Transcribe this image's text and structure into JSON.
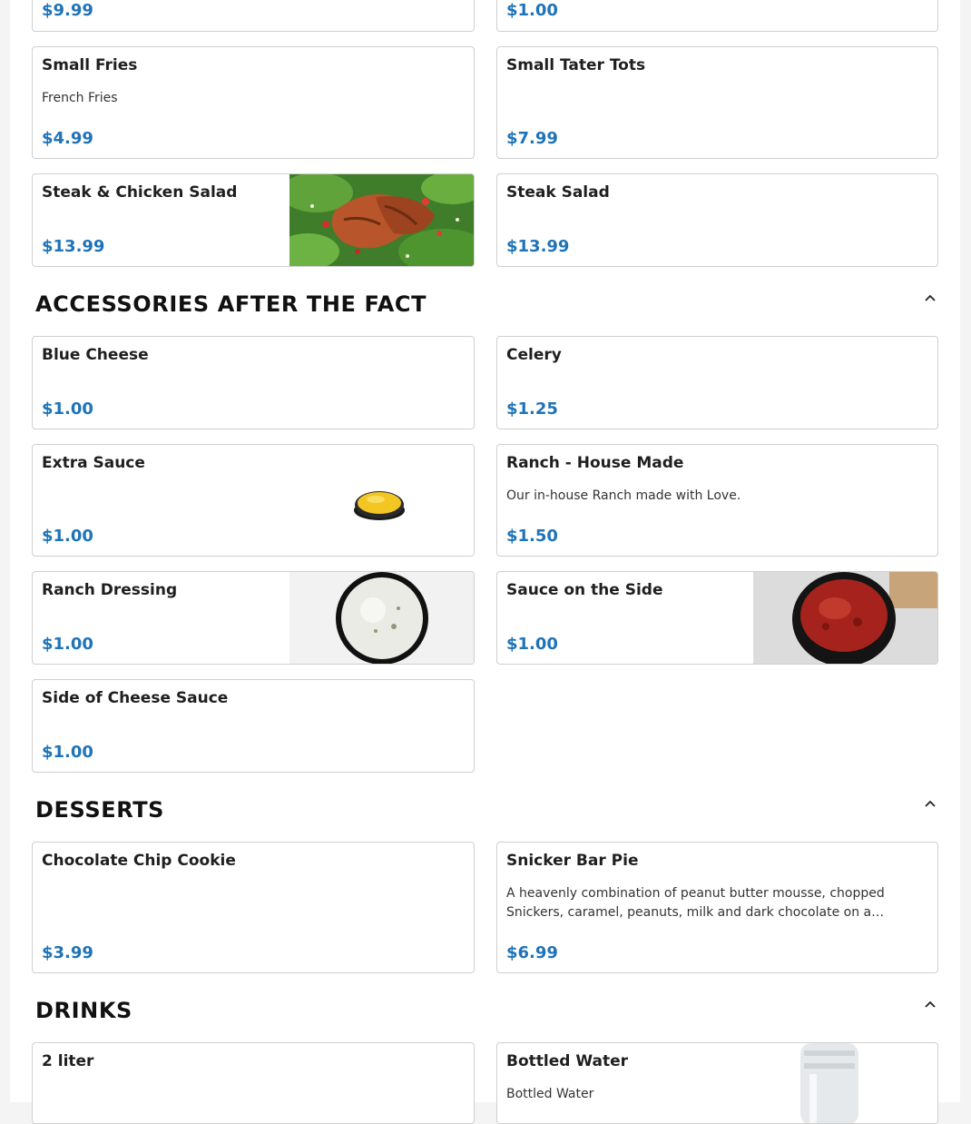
{
  "top_partial": {
    "left_price": "$9.99",
    "right_price": "$1.00"
  },
  "fries_row": {
    "small_fries": {
      "name": "Small Fries",
      "desc": "French Fries",
      "price": "$4.99"
    },
    "small_tater_tots": {
      "name": "Small Tater Tots",
      "price": "$7.99"
    }
  },
  "salad_row": {
    "steak_chicken_salad": {
      "name": "Steak & Chicken Salad",
      "price": "$13.99"
    },
    "steak_salad": {
      "name": "Steak Salad",
      "price": "$13.99"
    }
  },
  "accessories": {
    "title": "ACCESSORIES AFTER THE FACT",
    "blue_cheese": {
      "name": "Blue Cheese",
      "price": "$1.00"
    },
    "celery": {
      "name": "Celery",
      "price": "$1.25"
    },
    "extra_sauce": {
      "name": "Extra Sauce",
      "price": "$1.00"
    },
    "ranch_house": {
      "name": "Ranch - House Made",
      "desc": "Our in-house Ranch made with Love.",
      "price": "$1.50"
    },
    "ranch_dressing": {
      "name": "Ranch Dressing",
      "price": "$1.00"
    },
    "sauce_side": {
      "name": "Sauce on the Side",
      "price": "$1.00"
    },
    "cheese_sauce": {
      "name": "Side of Cheese Sauce",
      "price": "$1.00"
    }
  },
  "desserts": {
    "title": "DESSERTS",
    "cookie": {
      "name": "Chocolate Chip Cookie",
      "price": "$3.99"
    },
    "snicker_pie": {
      "name": "Snicker Bar Pie",
      "desc": "A heavenly combination of peanut butter mousse, chopped Snickers, caramel, peanuts, milk and dark chocolate on a…",
      "price": "$6.99"
    }
  },
  "drinks": {
    "title": "DRINKS",
    "two_liter": {
      "name": "2 liter"
    },
    "bottled_water": {
      "name": "Bottled Water",
      "desc": "Bottled Water"
    }
  },
  "colors": {
    "price_accent": "#1f73b7",
    "card_border": "#cfcfcf"
  },
  "icons": {
    "collapse": "chevron-up-icon"
  }
}
